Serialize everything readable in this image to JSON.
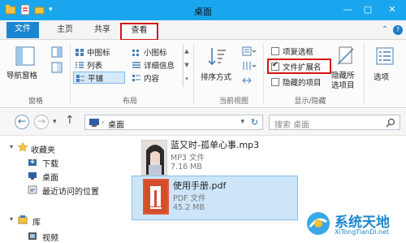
{
  "window": {
    "title": "桌面"
  },
  "tabs": {
    "file": "文件",
    "home": "主页",
    "share": "共享",
    "view": "查看"
  },
  "ribbon": {
    "pane": {
      "nav_pane": "导航窗格",
      "label": "窗格"
    },
    "layout": {
      "medium_icons": "中图标",
      "small_icons": "小图标",
      "list": "列表",
      "details": "详细信息",
      "tiles": "平铺",
      "content": "内容",
      "label": "布局"
    },
    "current_view": {
      "sort_by": "排序方式",
      "label": "当前视图"
    },
    "show_hide": {
      "item_check_boxes": "项复选框",
      "file_name_extensions": "文件扩展名",
      "file_name_extensions_checked": true,
      "hidden_items": "隐藏的项目",
      "hide_selected_1": "隐藏所",
      "hide_selected_2": "选项目",
      "label": "显示/隐藏"
    },
    "options": "选项"
  },
  "address": {
    "path": "桌面",
    "search_placeholder": "搜索 桌面"
  },
  "nav": {
    "favorites": "收藏夹",
    "downloads": "下载",
    "desktop": "桌面",
    "recent": "最近访问的位置",
    "libraries": "库",
    "videos": "视频"
  },
  "files": [
    {
      "name": "蓝又时-孤单心事.mp3",
      "type": "MP3 文件",
      "size": "7.16 MB"
    },
    {
      "name": "使用手册.pdf",
      "type": "PDF 文件",
      "size": "45.2 MB"
    }
  ],
  "watermark": {
    "text": "系统天地",
    "url": "XiTongTianDi.net"
  },
  "colors": {
    "title_bar": "#19a6ef",
    "file_tab": "#1a86d0",
    "highlight_box": "#d31515",
    "selection": "#cce5f9"
  }
}
